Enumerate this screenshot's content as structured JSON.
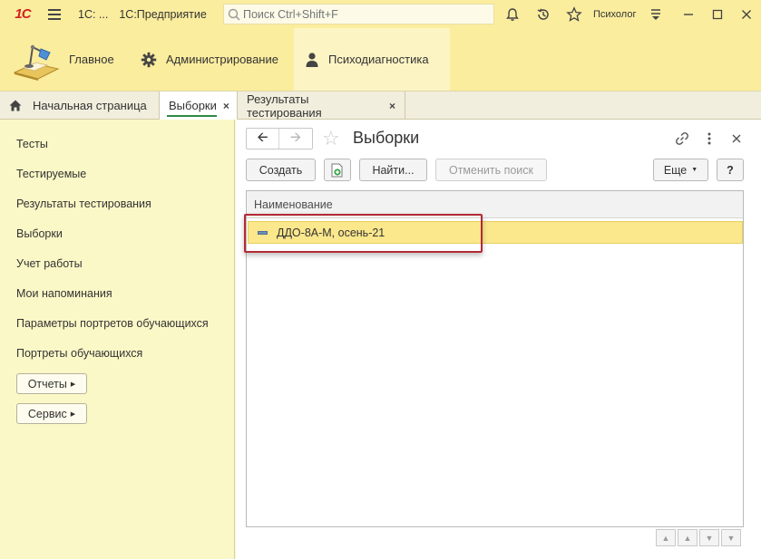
{
  "titlebar": {
    "logo": "1С",
    "app_short": "1С: ...",
    "app_name": "1С:Предприятие",
    "search_placeholder": "Поиск Ctrl+Shift+F",
    "user": "Психолог"
  },
  "sections": [
    {
      "label": "Главное",
      "icon": "desk-lamp-icon"
    },
    {
      "label": "Администрирование",
      "icon": "gear-icon"
    },
    {
      "label": "Психодиагностика",
      "icon": "person-icon"
    }
  ],
  "open_tabs": [
    {
      "label": "Начальная страница",
      "icon": "home-icon"
    },
    {
      "label": "Выборки",
      "close": "×"
    },
    {
      "label": "Результаты тестирования",
      "close": "×"
    }
  ],
  "nav": {
    "items": [
      "Тесты",
      "Тестируемые",
      "Результаты тестирования",
      "Выборки",
      "Учет работы",
      "Мои напоминания",
      "Параметры портретов обучающихся",
      "Портреты обучающихся"
    ],
    "reports_button": "Отчеты",
    "service_button": "Сервис"
  },
  "form": {
    "title": "Выборки",
    "buttons": {
      "create": "Создать",
      "find": "Найти...",
      "cancel_search": "Отменить поиск",
      "more": "Еще",
      "help": "?"
    },
    "table": {
      "columns": [
        "Наименование"
      ],
      "rows": [
        {
          "name": "ДДО-8А-М, осень-21"
        }
      ]
    }
  },
  "colors": {
    "panel": "#fbed9e",
    "nav_bg": "#fbf8c7",
    "selected_row": "#fbe78c",
    "highlight_frame": "#b32a36",
    "active_tab_underline": "#2d8a44"
  }
}
